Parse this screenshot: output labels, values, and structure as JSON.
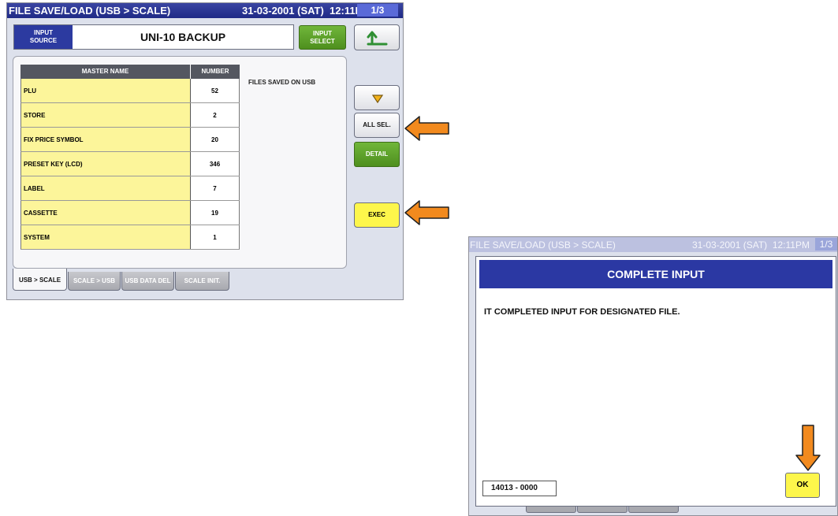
{
  "main": {
    "title": "FILE SAVE/LOAD (USB > SCALE)",
    "datetime": "31-03-2001 (SAT)  12:11PM",
    "page": "1/3",
    "input_source_label": "INPUT\nSOURCE",
    "input_source_value": "UNI-10 BACKUP",
    "input_select_label": "INPUT\nSELECT",
    "table": {
      "headers": [
        "MASTER NAME",
        "NUMBER"
      ],
      "rows": [
        {
          "name": "PLU",
          "number": "52"
        },
        {
          "name": "STORE",
          "number": "2"
        },
        {
          "name": "FIX PRICE SYMBOL",
          "number": "20"
        },
        {
          "name": "PRESET KEY (LCD)",
          "number": "346"
        },
        {
          "name": "LABEL",
          "number": "7"
        },
        {
          "name": "CASSETTE",
          "number": "19"
        },
        {
          "name": "SYSTEM",
          "number": "1"
        }
      ]
    },
    "files_note": "FILES SAVED ON USB",
    "buttons": {
      "all_sel": "ALL SEL.",
      "detail": "DETAIL",
      "exec": "EXEC"
    },
    "tabs": [
      "USB > SCALE",
      "SCALE > USB",
      "USB DATA DEL",
      "SCALE INIT."
    ]
  },
  "dialog_screen": {
    "title": "FILE SAVE/LOAD (USB > SCALE)",
    "datetime": "31-03-2001 (SAT)  12:11PM",
    "page": "1/3",
    "dialog_title": "COMPLETE INPUT",
    "message": "IT COMPLETED INPUT FOR DESIGNATED FILE.",
    "code": "14013 - 0000",
    "ok_label": "OK"
  },
  "colors": {
    "title_bar": "#1f2a86",
    "accent_blue": "#2b38a3",
    "yellow_button": "#fdf64b",
    "green_button": "#5a9f28",
    "row_yellow": "#fcf59a",
    "arrow_orange": "#f28a1e"
  },
  "icons": [
    "back-arrow-icon",
    "down-triangle-icon"
  ]
}
